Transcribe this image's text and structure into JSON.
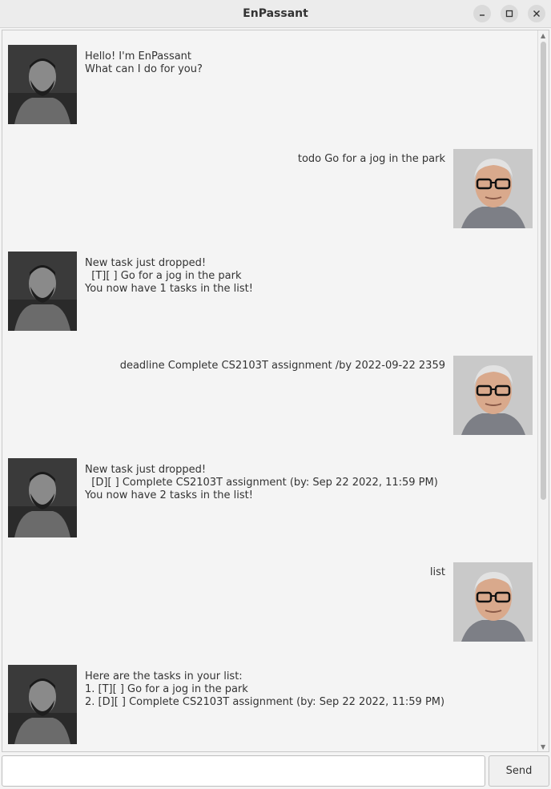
{
  "window": {
    "title": "EnPassant",
    "minimize_icon": "minimize-icon",
    "maximize_icon": "maximize-icon",
    "close_icon": "close-icon"
  },
  "messages": [
    {
      "sender": "bot",
      "avatar": "bot-avatar",
      "text": "Hello! I'm EnPassant\nWhat can I do for you?"
    },
    {
      "sender": "user",
      "avatar": "user-avatar",
      "text": "todo Go for a jog in the park"
    },
    {
      "sender": "bot",
      "avatar": "bot-avatar",
      "text": "New task just dropped!\n  [T][ ] Go for a jog in the park\nYou now have 1 tasks in the list!"
    },
    {
      "sender": "user",
      "avatar": "user-avatar",
      "text": "deadline Complete CS2103T assignment /by 2022-09-22 2359"
    },
    {
      "sender": "bot",
      "avatar": "bot-avatar",
      "text": "New task just dropped!\n  [D][ ] Complete CS2103T assignment (by: Sep 22 2022, 11:59 PM)\nYou now have 2 tasks in the list!"
    },
    {
      "sender": "user",
      "avatar": "user-avatar",
      "text": "list"
    },
    {
      "sender": "bot",
      "avatar": "bot-avatar",
      "text": "Here are the tasks in your list:\n1. [T][ ] Go for a jog in the park\n2. [D][ ] Complete CS2103T assignment (by: Sep 22 2022, 11:59 PM)"
    }
  ],
  "input": {
    "value": "",
    "placeholder": ""
  },
  "send_button": {
    "label": "Send"
  }
}
